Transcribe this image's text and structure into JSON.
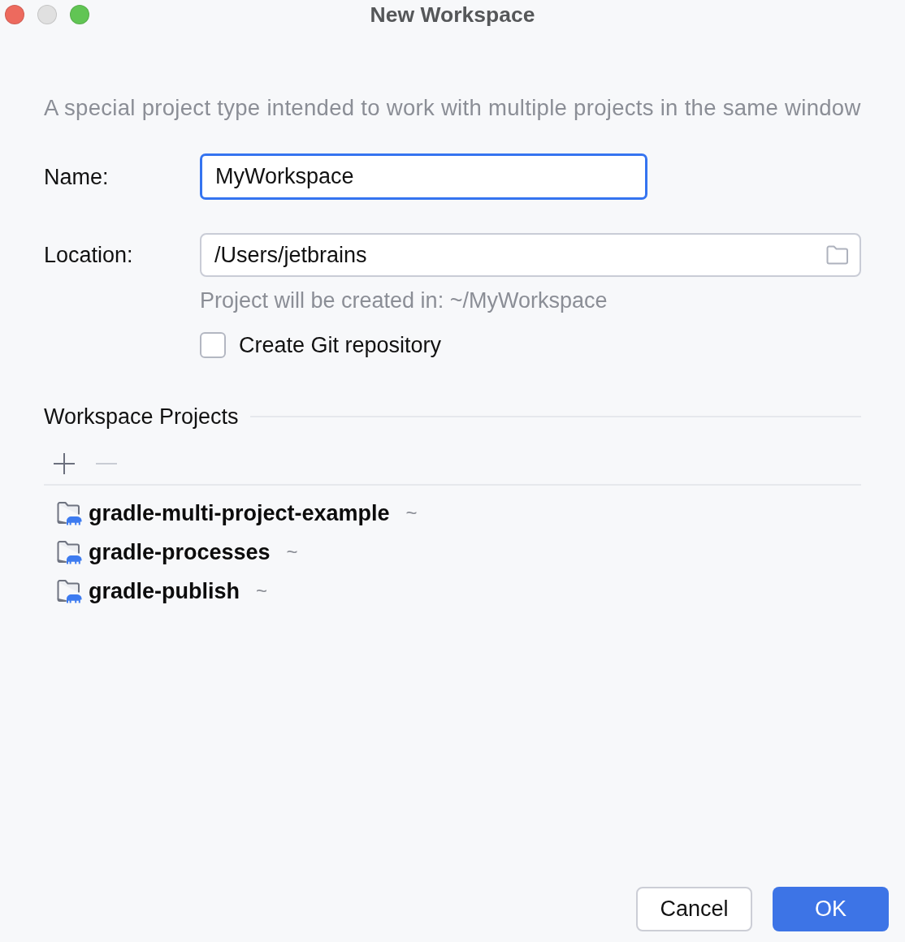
{
  "window": {
    "title": "New Workspace",
    "controls": [
      {
        "kind": "close",
        "disabled": false
      },
      {
        "kind": "minimize",
        "disabled": true
      },
      {
        "kind": "zoom",
        "disabled": false
      }
    ]
  },
  "description": "A special project type intended to work with multiple projects in the same window",
  "name_field": {
    "label": "Name:",
    "value": "MyWorkspace",
    "focused": true
  },
  "location_field": {
    "label": "Location:",
    "value": "/Users/jetbrains",
    "focused": false
  },
  "location_hint": "Project will be created in: ~/MyWorkspace",
  "git_checkbox": {
    "label": "Create Git repository",
    "checked": false
  },
  "workspace_projects": {
    "title": "Workspace Projects",
    "toolbar": [
      {
        "kind": "add",
        "disabled": false
      },
      {
        "kind": "remove",
        "disabled": true
      }
    ],
    "items": [
      {
        "name": "gradle-multi-project-example",
        "path": "~"
      },
      {
        "name": "gradle-processes",
        "path": "~"
      },
      {
        "name": "gradle-publish",
        "path": "~"
      }
    ]
  },
  "buttons": [
    {
      "label": "Cancel",
      "kind": "secondary"
    },
    {
      "label": "OK",
      "kind": "primary"
    }
  ]
}
